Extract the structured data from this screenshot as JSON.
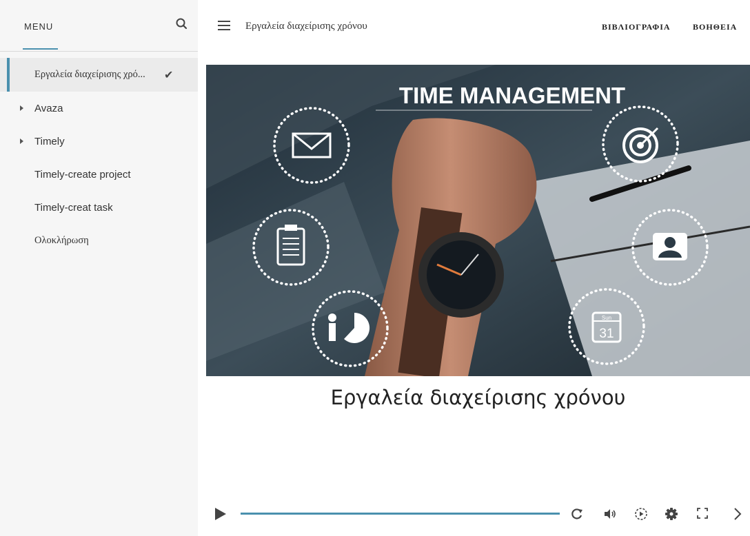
{
  "sidebar": {
    "menu_title": "MENU",
    "items": [
      {
        "label": "Εργαλεία διαχείρισης χρό...",
        "active": true,
        "completed": true,
        "expandable": false
      },
      {
        "label": "Avaza",
        "active": false,
        "completed": false,
        "expandable": true
      },
      {
        "label": "Timely",
        "active": false,
        "completed": false,
        "expandable": true
      },
      {
        "label": "Timely-create project",
        "active": false,
        "completed": false,
        "expandable": false
      },
      {
        "label": "Timely-creat task",
        "active": false,
        "completed": false,
        "expandable": false
      },
      {
        "label": "Ολοκλήρωση",
        "active": false,
        "completed": false,
        "expandable": false
      }
    ]
  },
  "header": {
    "course_title": "Εργαλεία διαχείρισης χρόνου",
    "links": [
      "ΒΙΒΛΙΟΓΡΑΦΙΑ",
      "ΒΟΗΘΕΙΑ"
    ]
  },
  "hero": {
    "banner_text": "TIME MANAGEMENT",
    "calendar_day": "Sun",
    "calendar_date": "31"
  },
  "slide": {
    "title": "Εργαλεία διαχείρισης χρόνου"
  },
  "player": {
    "progress": 1.0,
    "icons": [
      "play-icon",
      "replay-icon",
      "volume-icon",
      "playback-speed-icon",
      "settings-icon",
      "fullscreen-icon",
      "next-icon"
    ]
  },
  "colors": {
    "accent": "#4a90ae",
    "sidebar_bg": "#f6f6f6",
    "active_item_bg": "#ebebeb"
  }
}
